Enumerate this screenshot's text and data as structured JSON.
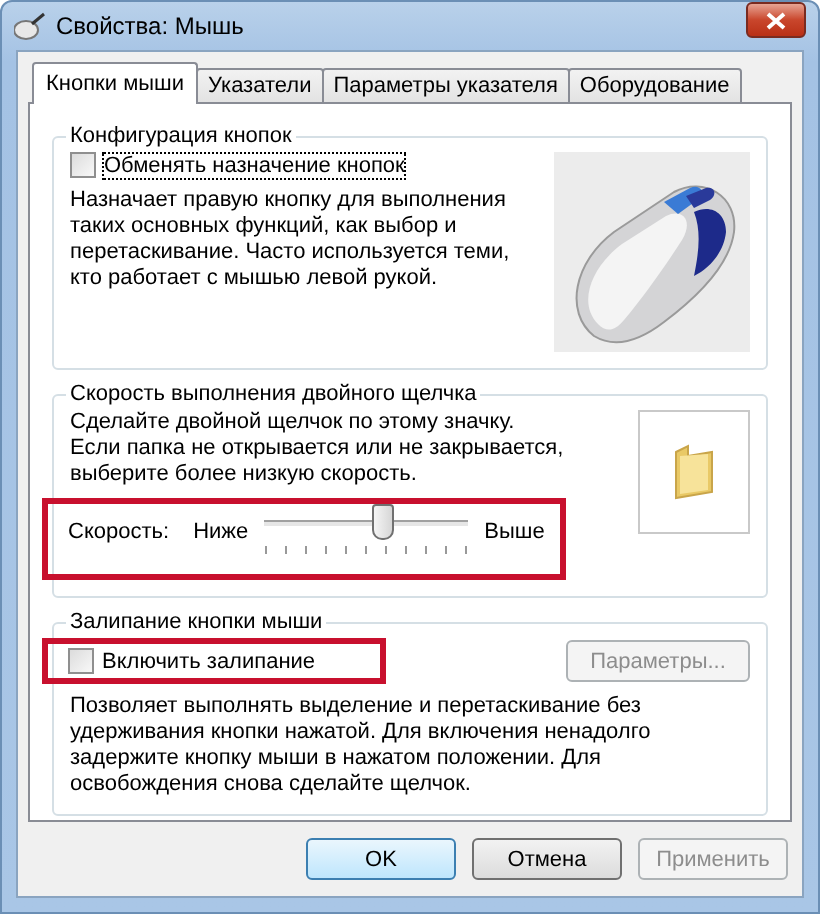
{
  "window": {
    "title": "Свойства: Мышь"
  },
  "tabs": [
    {
      "label": "Кнопки мыши",
      "selected": true
    },
    {
      "label": "Указатели",
      "selected": false
    },
    {
      "label": "Параметры указателя",
      "selected": false
    },
    {
      "label": "Оборудование",
      "selected": false
    }
  ],
  "button_config": {
    "title": "Конфигурация кнопок",
    "swap_checkbox": {
      "label": "Обменять назначение кнопок",
      "checked": false
    },
    "description": "Назначает правую кнопку для выполнения таких основных функций, как выбор и перетаскивание. Часто используется теми, кто работает с мышью левой рукой."
  },
  "double_click": {
    "title": "Скорость выполнения двойного щелчка",
    "description": "Сделайте двойной щелчок по этому значку. Если папка не открывается или не закрывается, выберите более низкую скорость.",
    "speed": {
      "label": "Скорость:",
      "low": "Ниже",
      "high": "Выше",
      "level": 0.58
    }
  },
  "click_lock": {
    "title": "Залипание кнопки мыши",
    "checkbox": {
      "label": "Включить залипание",
      "checked": false
    },
    "settings_button": {
      "label": "Параметры...",
      "disabled": true
    },
    "description": "Позволяет выполнять выделение и перетаскивание без удерживания кнопки нажатой. Для включения ненадолго задержите кнопку мыши в нажатом положении. Для освобождения снова сделайте щелчок."
  },
  "buttons": [
    {
      "label": "OK",
      "default": true,
      "disabled": false
    },
    {
      "label": "Отмена",
      "default": false,
      "disabled": false
    },
    {
      "label": "Применить",
      "default": false,
      "disabled": true
    }
  ]
}
